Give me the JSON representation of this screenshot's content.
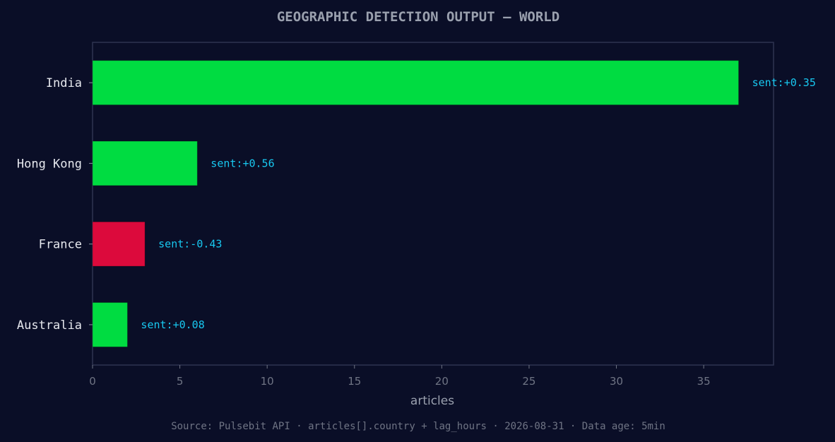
{
  "chart_data": {
    "type": "bar",
    "orientation": "horizontal",
    "title": "GEOGRAPHIC DETECTION OUTPUT — WORLD",
    "xlabel": "articles",
    "ylabel": "",
    "xlim": [
      0,
      39
    ],
    "xticks": [
      0,
      5,
      10,
      15,
      20,
      25,
      30,
      35
    ],
    "grid": false,
    "categories": [
      "India",
      "Hong Kong",
      "France",
      "Australia"
    ],
    "values": [
      37,
      6,
      3,
      2
    ],
    "sentiment_labels": [
      "sent:+0.35",
      "sent:+0.56",
      "sent:-0.43",
      "sent:+0.08"
    ],
    "bar_colors": [
      "#00dc41",
      "#00dc41",
      "#dc0a3c",
      "#00dc41"
    ],
    "colors": {
      "background": "#0a0e27",
      "positive": "#00dc41",
      "negative": "#dc0a3c",
      "data_label": "#18c8f0",
      "frame": "#2e3450"
    }
  },
  "footer": {
    "source": "Source: Pulsebit API · articles[].country + lag_hours · 2026-08-31 · Data age: 5min"
  }
}
